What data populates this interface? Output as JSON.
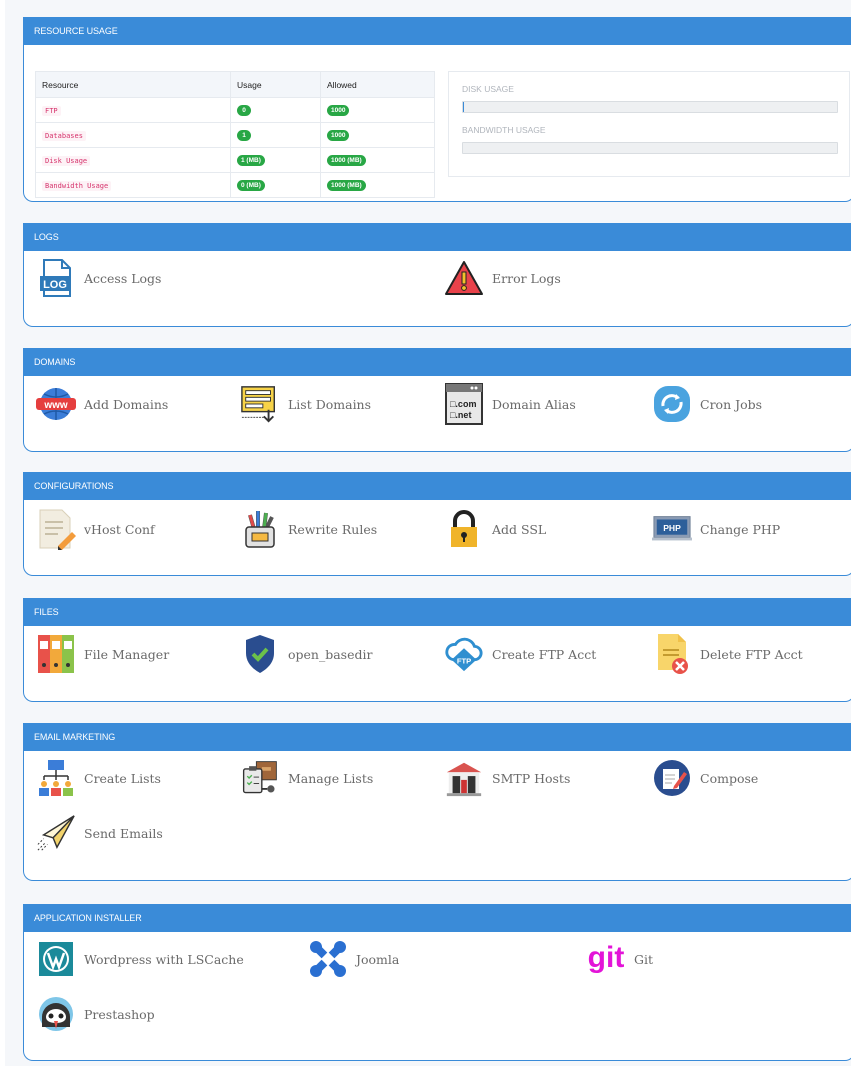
{
  "resource": {
    "title": "RESOURCE USAGE",
    "headers": [
      "Resource",
      "Usage",
      "Allowed"
    ],
    "rows": [
      {
        "name": "FTP",
        "usage": "0",
        "allowed": "1000"
      },
      {
        "name": "Databases",
        "usage": "1",
        "allowed": "1000"
      },
      {
        "name": "Disk Usage",
        "usage": "1 (MB)",
        "allowed": "1000 (MB)"
      },
      {
        "name": "Bandwidth Usage",
        "usage": "0 (MB)",
        "allowed": "1000 (MB)"
      }
    ],
    "disk_label": "DISK USAGE",
    "disk_fraction": 0.001,
    "bandwidth_label": "BANDWIDTH USAGE",
    "bandwidth_fraction": 0
  },
  "logs": {
    "title": "LOGS",
    "items": [
      "Access Logs",
      "Error Logs"
    ],
    "icons": [
      "log-file-icon",
      "warning-icon"
    ]
  },
  "domains": {
    "title": "DOMAINS",
    "items": [
      "Add Domains",
      "List Domains",
      "Domain Alias",
      "Cron Jobs"
    ],
    "icons": [
      "www-globe-icon",
      "list-icon",
      "domain-alias-icon",
      "cron-icon"
    ]
  },
  "configurations": {
    "title": "CONFIGURATIONS",
    "items": [
      "vHost Conf",
      "Rewrite Rules",
      "Add SSL",
      "Change PHP"
    ],
    "icons": [
      "document-edit-icon",
      "pencil-cup-icon",
      "lock-icon",
      "php-icon"
    ]
  },
  "files": {
    "title": "FILES",
    "items": [
      "File Manager",
      "open_basedir",
      "Create FTP Acct",
      "Delete FTP Acct"
    ],
    "icons": [
      "folders-icon",
      "shield-check-icon",
      "ftp-cloud-icon",
      "file-delete-icon"
    ]
  },
  "email": {
    "title": "EMAIL MARKETING",
    "items": [
      "Create Lists",
      "Manage Lists",
      "SMTP Hosts",
      "Compose",
      "Send Emails"
    ],
    "icons": [
      "people-icon",
      "clipboard-box-icon",
      "building-icon",
      "compose-icon",
      "paper-plane-icon"
    ]
  },
  "apps": {
    "title": "APPLICATION INSTALLER",
    "items": [
      "Wordpress with LSCache",
      "Joomla",
      "Git",
      "Prestashop"
    ],
    "icons": [
      "wordpress-icon",
      "joomla-icon",
      "git-icon",
      "prestashop-icon"
    ]
  },
  "icon_texts": {
    "log": "LOG",
    "com": "□.com",
    "net": "□.net",
    "php": "PHP",
    "ftp": "FTP",
    "git": "git"
  },
  "colors": {
    "accent": "#3a8bd8",
    "badge": "#28a745",
    "code": "#d6336c"
  }
}
